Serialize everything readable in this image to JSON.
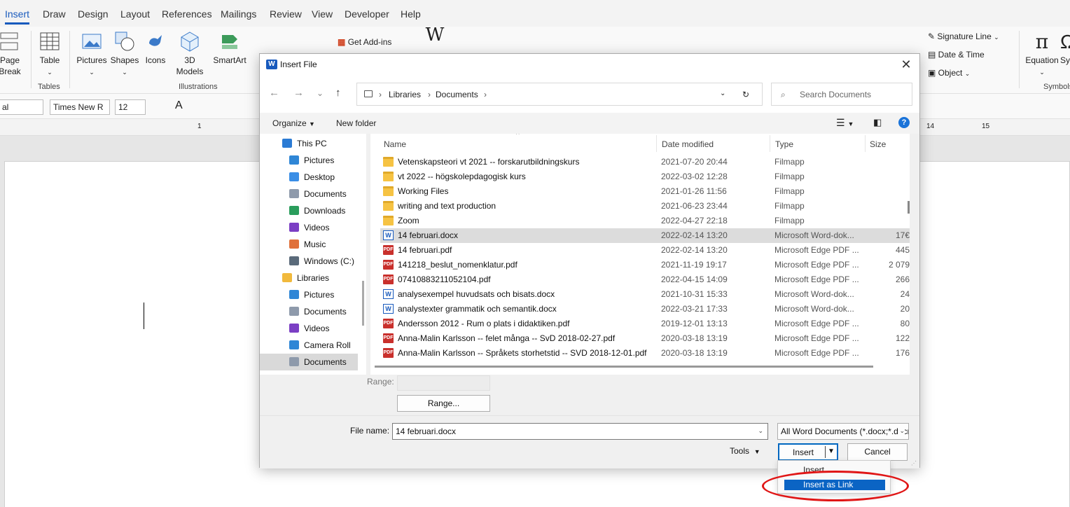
{
  "word": {
    "tabs": [
      "Insert",
      "Draw",
      "Design",
      "Layout",
      "References",
      "Mailings",
      "Review",
      "View",
      "Developer",
      "Help"
    ],
    "ribbon": {
      "page_break": "Page Break",
      "table": "Table",
      "pictures": "Pictures",
      "shapes": "Shapes",
      "icons": "Icons",
      "models_3d": "3D Models",
      "smartart": "SmartArt",
      "get_addins": "Get Add-ins",
      "wikipedia": "W",
      "signature_line": "Signature Line",
      "date_time": "Date & Time",
      "object": "Object",
      "equation": "Equation",
      "symbol_cut": "Sy",
      "groups": {
        "tables": "Tables",
        "illustrations": "Illustrations",
        "symbols": "Symbols"
      }
    },
    "font": {
      "style": "al",
      "name": "Times New R",
      "size": "12"
    },
    "ruler": {
      "n1": "1",
      "n14": "14",
      "n15": "15"
    }
  },
  "dialog": {
    "title": "Insert File",
    "close": "✕",
    "nav": {
      "back": "←",
      "forward": "→",
      "recent": "⌄",
      "up": "↑"
    },
    "address": [
      "Libraries",
      "Documents"
    ],
    "search_placeholder": "Search Documents",
    "toolbar": {
      "organize": "Organize",
      "new_folder": "New folder"
    },
    "navpane": [
      {
        "label": "This PC",
        "icon": "computer-icon"
      },
      {
        "label": "Pictures",
        "icon": "pictures-icon"
      },
      {
        "label": "Desktop",
        "icon": "desktop-icon"
      },
      {
        "label": "Documents",
        "icon": "documents-icon"
      },
      {
        "label": "Downloads",
        "icon": "downloads-icon"
      },
      {
        "label": "Videos",
        "icon": "videos-icon"
      },
      {
        "label": "Music",
        "icon": "music-icon"
      },
      {
        "label": "Windows  (C:)",
        "icon": "drive-icon"
      },
      {
        "label": "Libraries",
        "icon": "libraries-icon"
      },
      {
        "label": "Pictures",
        "icon": "pictures-icon"
      },
      {
        "label": "Documents",
        "icon": "documents-icon"
      },
      {
        "label": "Videos",
        "icon": "videos-icon"
      },
      {
        "label": "Camera Roll",
        "icon": "camera-roll-icon"
      },
      {
        "label": "Documents",
        "icon": "documents-icon"
      }
    ],
    "columns": {
      "name": "Name",
      "date": "Date modified",
      "type": "Type",
      "size": "Size"
    },
    "files": [
      {
        "name": "Vetenskapsteori vt 2021 -- forskarutbildningskurs",
        "date": "2021-07-20 20:44",
        "type": "Filmapp",
        "size": "",
        "kind": "folder"
      },
      {
        "name": "vt 2022 -- högskolepdagogisk kurs",
        "date": "2022-03-02 12:28",
        "type": "Filmapp",
        "size": "",
        "kind": "folder"
      },
      {
        "name": "Working Files",
        "date": "2021-01-26 11:56",
        "type": "Filmapp",
        "size": "",
        "kind": "folder"
      },
      {
        "name": "writing and text production",
        "date": "2021-06-23 23:44",
        "type": "Filmapp",
        "size": "",
        "kind": "folder"
      },
      {
        "name": "Zoom",
        "date": "2022-04-27 22:18",
        "type": "Filmapp",
        "size": "",
        "kind": "folder"
      },
      {
        "name": "14 februari.docx",
        "date": "2022-02-14 13:20",
        "type": "Microsoft Word-dok...",
        "size": "17€",
        "kind": "docx"
      },
      {
        "name": "14 februari.pdf",
        "date": "2022-02-14 13:20",
        "type": "Microsoft Edge PDF ...",
        "size": "445",
        "kind": "pdf"
      },
      {
        "name": "141218_beslut_nomenklatur.pdf",
        "date": "2021-11-19 19:17",
        "type": "Microsoft Edge PDF ...",
        "size": "2 079",
        "kind": "pdf"
      },
      {
        "name": "07410883211052104.pdf",
        "date": "2022-04-15 14:09",
        "type": "Microsoft Edge PDF ...",
        "size": "266",
        "kind": "pdf"
      },
      {
        "name": "analysexempel huvudsats och bisats.docx",
        "date": "2021-10-31 15:33",
        "type": "Microsoft Word-dok...",
        "size": "24",
        "kind": "docx"
      },
      {
        "name": "analystexter grammatik och semantik.docx",
        "date": "2022-03-21 17:33",
        "type": "Microsoft Word-dok...",
        "size": "20",
        "kind": "docx"
      },
      {
        "name": "Andersson 2012 - Rum o plats i didaktiken.pdf",
        "date": "2019-12-01 13:13",
        "type": "Microsoft Edge PDF ...",
        "size": "80",
        "kind": "pdf"
      },
      {
        "name": "Anna-Malin Karlsson -- felet många -- SvD 2018-02-27.pdf",
        "date": "2020-03-18 13:19",
        "type": "Microsoft Edge PDF ...",
        "size": "122",
        "kind": "pdf"
      },
      {
        "name": "Anna-Malin Karlsson -- Språkets storhetstid -- SVD 2018-12-01.pdf",
        "date": "2020-03-18 13:19",
        "type": "Microsoft Edge PDF ...",
        "size": "176",
        "kind": "pdf"
      }
    ],
    "range_label": "Range:",
    "range_button": "Range...",
    "file_name_label": "File name:",
    "file_name_value": "14 februari.docx",
    "file_type_value": "All Word Documents (*.docx;*.docm)",
    "tools": "Tools",
    "insert": "Insert",
    "cancel": "Cancel"
  },
  "insert_menu": {
    "insert": "Insert",
    "insert_as_link": "Insert as Link"
  },
  "colors": {
    "accent": "#185abd",
    "selection": "#0b64c4",
    "annotation": "#e01616"
  }
}
